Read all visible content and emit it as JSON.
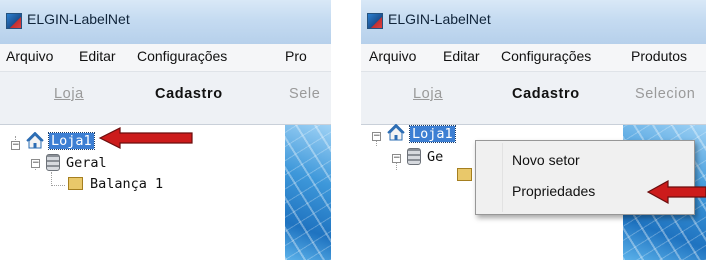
{
  "left_window": {
    "title": "ELGIN-LabelNet",
    "menu": [
      "Arquivo",
      "Editar",
      "Configurações",
      "Pro"
    ],
    "tabs": [
      {
        "label": "Loja",
        "active": false
      },
      {
        "label": "Cadastro",
        "active": true
      },
      {
        "label": "Sele",
        "active": false
      }
    ],
    "tree": {
      "root": "Loja1",
      "group": "Geral",
      "device": "Balança 1"
    }
  },
  "right_window": {
    "title": "ELGIN-LabelNet",
    "menu": [
      "Arquivo",
      "Editar",
      "Configurações",
      "Produtos"
    ],
    "tabs": [
      {
        "label": "Loja",
        "active": false
      },
      {
        "label": "Cadastro",
        "active": true
      },
      {
        "label": "Selecion",
        "active": false
      }
    ],
    "tree": {
      "root": "Loja1",
      "group_partial": "Ge"
    },
    "context_menu": {
      "items": [
        "Novo setor",
        "Propriedades"
      ]
    }
  },
  "icons": [
    "app-icon",
    "home-icon",
    "database-icon",
    "scale-icon",
    "red-arrow-icon"
  ],
  "colors": {
    "selection": "#3d7fd3",
    "arrow": "#cc1b1b",
    "titlebar": "#c5dbf1",
    "decor": "#2f86d0"
  }
}
